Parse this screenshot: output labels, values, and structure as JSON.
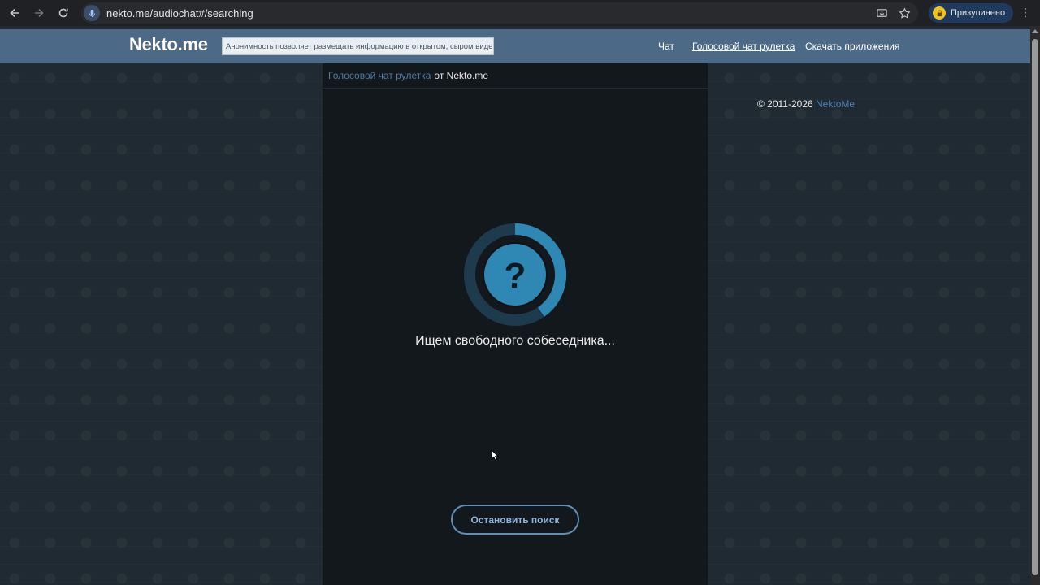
{
  "browser": {
    "url": "nekto.me/audiochat#/searching",
    "profile_label": "Призупинено"
  },
  "header": {
    "logo": "Nekto.me",
    "slogan": "Анонимность позволяет размещать информацию в открытом, сыром виде!",
    "nav": [
      {
        "label": "Чат"
      },
      {
        "label": "Голосовой чат рулетка",
        "active": true
      },
      {
        "label": "Скачать приложения"
      }
    ]
  },
  "panel": {
    "title_link": "Голосовой чат рулетка",
    "title_suffix": "от Nekto.me",
    "status_text": "Ищем свободного собеседника...",
    "stop_button": "Остановить поиск"
  },
  "footer": {
    "copyright": "© 2011-2026",
    "brand": "NektoMe"
  },
  "icons": {
    "spinner": "question-mark-icon",
    "colors": {
      "accent": "#2f87b3",
      "ring": "#1e3a4d"
    }
  }
}
